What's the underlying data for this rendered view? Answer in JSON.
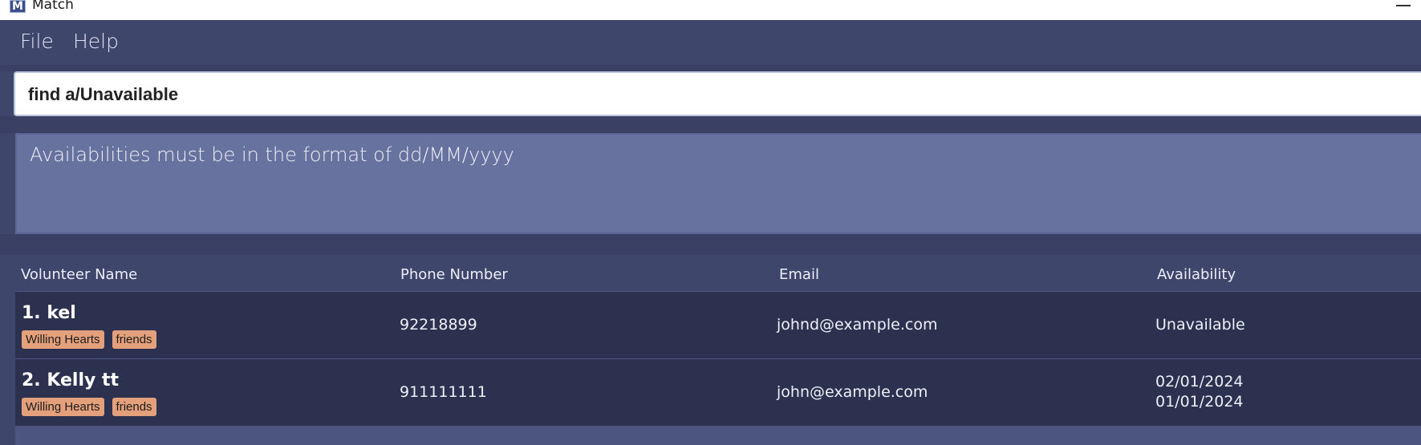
{
  "window": {
    "title": "Match",
    "icon_letter": "M"
  },
  "menu": {
    "file": "File",
    "help": "Help"
  },
  "command": {
    "value": "find a/Unavailable"
  },
  "result": {
    "message": "Availabilities must be in the format of dd/MM/yyyy"
  },
  "columns": {
    "name": "Volunteer Name",
    "phone": "Phone Number",
    "email": "Email",
    "availability": "Availability"
  },
  "volunteers": [
    {
      "name": "1. kel",
      "tags": [
        "Willing Hearts",
        "friends"
      ],
      "phone": "92218899",
      "email": "johnd@example.com",
      "availability": [
        "Unavailable"
      ]
    },
    {
      "name": "2. Kelly tt",
      "tags": [
        "Willing Hearts",
        "friends"
      ],
      "phone": "911111111",
      "email": "john@example.com",
      "availability": [
        "02/01/2024",
        "01/01/2024"
      ]
    }
  ],
  "colors": {
    "background": "#3f466b",
    "result_box": "#68729f",
    "row": "#2d3150",
    "tag": "#e4a07a"
  },
  "icons": {
    "app": "app-logo-icon",
    "minimize": "minimize-icon"
  }
}
